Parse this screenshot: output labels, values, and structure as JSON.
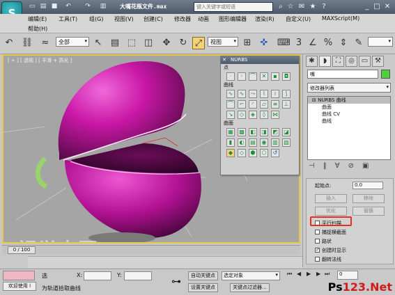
{
  "window": {
    "title": "大嘴花瓶文件.max",
    "search_placeholder": "键入关键字或短语"
  },
  "menubar": {
    "items": [
      "编辑(E)",
      "工具(T)",
      "组(G)",
      "视图(V)",
      "创建(C)",
      "修改器",
      "动画",
      "图形编辑器",
      "渲染(R)",
      "自定义(U)",
      "MAXScript(M)",
      "帮助(H)"
    ]
  },
  "toolbar": {
    "selection_filter": "全部",
    "ref_coord": "视图"
  },
  "viewport": {
    "label": "[ + ] [ 透视 ] [ 平滑 + 高光 ]",
    "frame": "0 / 100",
    "watermark": "视觉中国 WWW.TLVI.NET"
  },
  "nurbs_panel": {
    "title": "NURBS",
    "sections": [
      "点",
      "曲线",
      "曲面"
    ]
  },
  "command_panel": {
    "object_name": "嘴",
    "modifier_list": "修改器列表",
    "stack_items": [
      "NURBS 曲线",
      "曲面",
      "曲线 CV",
      "曲线"
    ],
    "rollout": {
      "start_point_label": "起始点:",
      "start_point_value": "0.0",
      "insert_btn": "插入",
      "remove_btn": "移除",
      "optimize_btn": "优化",
      "replace_btn": "替换",
      "checks": [
        {
          "label": "平行扫描",
          "checked": false
        },
        {
          "label": "捕捉横截面",
          "checked": false
        },
        {
          "label": "路状",
          "checked": false
        },
        {
          "label": "创建时显示",
          "checked": true
        },
        {
          "label": "翻转法线",
          "checked": false
        }
      ]
    }
  },
  "status": {
    "welcome": "欢迎使用 l",
    "prompt": "为轨道拾取曲线",
    "selected_label": "选",
    "x_label": "X:",
    "y_label": "Y:",
    "auto_key": "自动关键点",
    "set_key": "设置关键点",
    "select_dropdown": "选定对象",
    "key_filter": "关键点过滤器...",
    "frame_value": "0",
    "logo_main": "Ps",
    "logo_sub": "123.Net"
  },
  "colors": {
    "accent": "#e9c74a",
    "object_magenta": "#d21fb8",
    "swatch_green": "#4ecf3b",
    "highlight_red": "#e0301e"
  }
}
